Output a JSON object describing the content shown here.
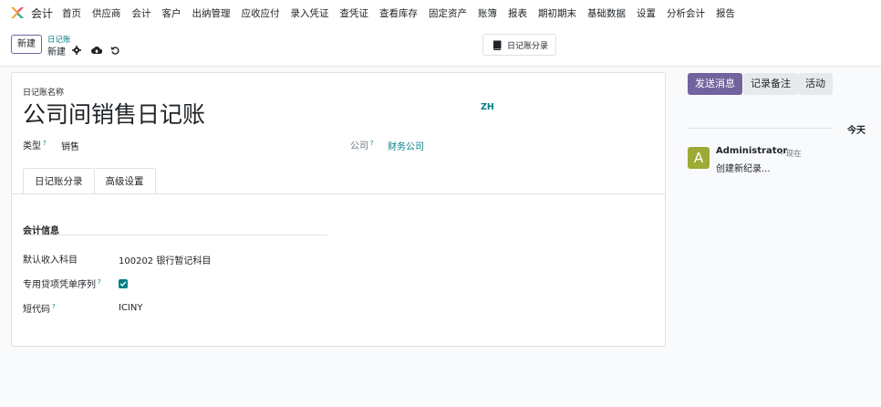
{
  "navbar": {
    "app_name": "会计",
    "items": [
      "首页",
      "供应商",
      "会计",
      "客户",
      "出纳管理",
      "应收应付",
      "录入凭证",
      "查凭证",
      "查看库存",
      "固定资产",
      "账簿",
      "报表",
      "期初期末",
      "基础数据",
      "设置",
      "分析会计",
      "报告"
    ]
  },
  "control": {
    "new_label": "新建",
    "breadcrumb_parent": "日记账",
    "breadcrumb_current": "新建",
    "smart_button_label": "日记账分录"
  },
  "form": {
    "name_label": "日记账名称",
    "name_value": "公司间销售日记账",
    "lang": "ZH",
    "type_label": "类型",
    "type_value": "销售",
    "company_label": "公司",
    "company_value": "财务公司",
    "help_mark": "?",
    "tabs": [
      "日记账分录",
      "高级设置"
    ],
    "section_title": "会计信息",
    "fields": {
      "default_income_label": "默认收入科目",
      "default_income_value": "100202 银行暂记科目",
      "dedicated_seq_label": "专用贷项凭单序列",
      "short_code_label": "短代码",
      "short_code_value": "ICINY"
    }
  },
  "chatter": {
    "send_message": "发送消息",
    "log_note": "记录备注",
    "activity": "活动",
    "today": "今天",
    "avatar_letter": "A",
    "author": "Administrator",
    "time": "- 现在",
    "message": "创建新纪录..."
  },
  "colors": {
    "primary": "#71639e",
    "link": "#017e84",
    "avatar": "#9cab35"
  }
}
